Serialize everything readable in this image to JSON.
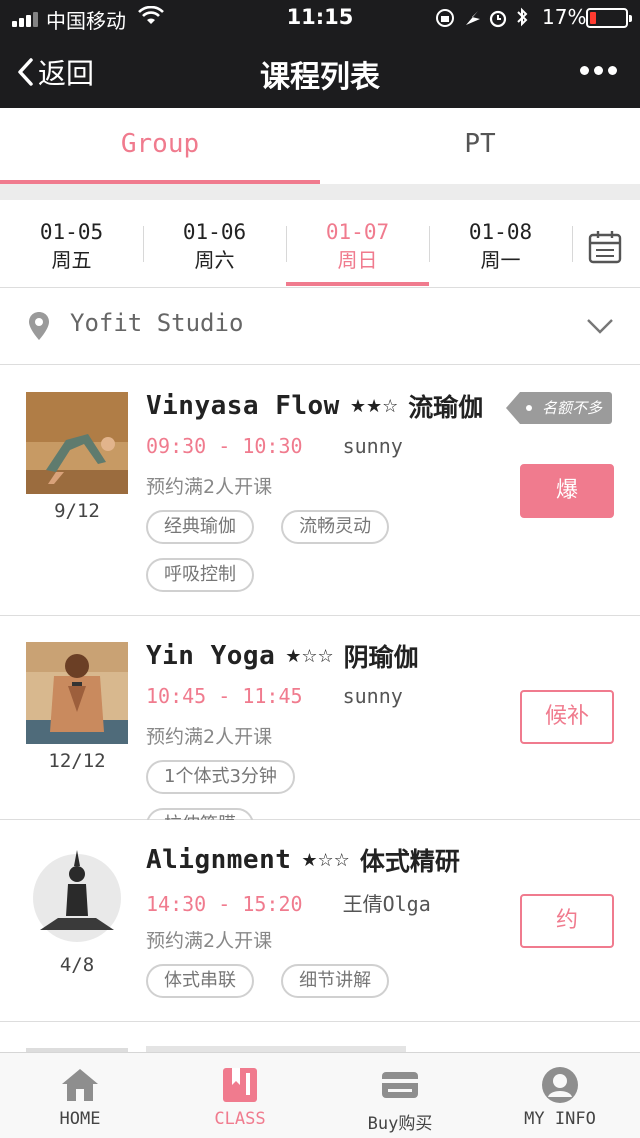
{
  "status_bar": {
    "carrier": "中国移动",
    "time": "11:15",
    "battery": "17%",
    "battery_level": 0.17
  },
  "nav": {
    "back_label": "返回",
    "title": "课程列表"
  },
  "top_tabs": [
    {
      "label": "Group",
      "active": true
    },
    {
      "label": "PT",
      "active": false
    }
  ],
  "dates": [
    {
      "date": "01-05",
      "weekday": "周五",
      "active": false
    },
    {
      "date": "01-06",
      "weekday": "周六",
      "active": false
    },
    {
      "date": "01-07",
      "weekday": "周日",
      "active": true
    },
    {
      "date": "01-08",
      "weekday": "周一",
      "active": false
    }
  ],
  "studio": {
    "name": "Yofit Studio"
  },
  "classes": [
    {
      "name_en": "Vinyasa Flow",
      "stars": "★★☆",
      "rating": 2,
      "name_cn": "流瑜伽",
      "time": "09:30 - 10:30",
      "coach": "sunny",
      "note": "预约满2人开课",
      "tags": [
        "经典瑜伽",
        "流畅灵动",
        "呼吸控制"
      ],
      "count": "9/12",
      "badge": "名额不多",
      "action": "爆",
      "action_style": "filled"
    },
    {
      "name_en": "Yin Yoga",
      "stars": "★☆☆",
      "rating": 1,
      "name_cn": "阴瑜伽",
      "time": "10:45 - 11:45",
      "coach": "sunny",
      "note": "预约满2人开课",
      "tags": [
        "1个体式3分钟",
        "拉伸筋膜"
      ],
      "count": "12/12",
      "action": "候补",
      "action_style": "outline"
    },
    {
      "name_en": "Alignment",
      "stars": "★☆☆",
      "rating": 1,
      "name_cn": "体式精研",
      "time": "14:30 - 15:20",
      "coach": "王倩Olga",
      "note": "预约满2人开课",
      "tags": [
        "体式串联",
        "细节讲解"
      ],
      "count": "4/8",
      "action": "约",
      "action_style": "outline"
    }
  ],
  "tab_bar": [
    {
      "label": "HOME",
      "icon": "home-icon",
      "active": false
    },
    {
      "label": "CLASS",
      "icon": "class-icon",
      "active": true
    },
    {
      "label": "Buy购买",
      "icon": "wallet-icon",
      "active": false
    },
    {
      "label": "MY INFO",
      "icon": "profile-icon",
      "active": false
    }
  ],
  "colors": {
    "accent": "#f07b8e",
    "header_bg": "#1c1c1e",
    "badge_bg": "#9b9b9b"
  }
}
